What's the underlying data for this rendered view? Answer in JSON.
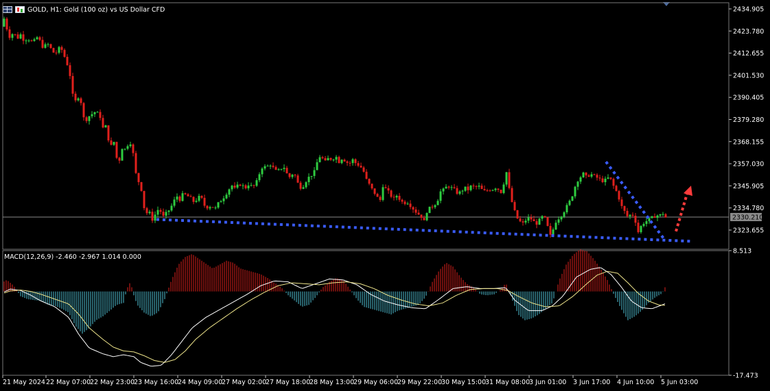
{
  "window": {
    "symbol": "GOLD",
    "timeframe": "H1",
    "description": "Gold (100 oz) vs US Dollar CFD",
    "title": "GOLD, H1:  Gold (100 oz) vs US Dollar CFD"
  },
  "price_axis": {
    "labels": [
      "2434.905",
      "2423.780",
      "2412.655",
      "2401.530",
      "2390.405",
      "2379.280",
      "2368.155",
      "2357.030",
      "2345.905",
      "2334.780",
      "2323.655"
    ],
    "values": [
      2434.905,
      2423.78,
      2412.655,
      2401.53,
      2390.405,
      2379.28,
      2368.155,
      2357.03,
      2345.905,
      2334.78,
      2323.655
    ],
    "current_price_label": "2330.210",
    "current_price": 2330.21,
    "range": [
      2314.0,
      2438.0
    ]
  },
  "macd": {
    "label": "MACD(12,26,9) -2.460 -2.967 1.014 0.000",
    "axis_labels": [
      "8.513",
      "-17.473"
    ],
    "axis_values": [
      8.513,
      -17.473
    ]
  },
  "time_axis": {
    "labels": [
      "21 May 2024",
      "22 May 07:00",
      "22 May 23:00",
      "23 May 16:00",
      "24 May 09:00",
      "27 May 02:00",
      "27 May 18:00",
      "28 May 13:00",
      "29 May 06:00",
      "29 May 22:00",
      "30 May 15:00",
      "31 May 08:00",
      "3 Jun 01:00",
      "3 Jun 17:00",
      "4 Jun 10:00",
      "5 Jun 03:00"
    ]
  },
  "colors": {
    "background": "#000000",
    "bull": "#2ecc40",
    "bear": "#e0201c",
    "grid": "#3a3a3a",
    "axis": "#c0c0c0",
    "macd_pos": "#e0201c",
    "macd_neg": "#4fc3d9",
    "macd_line": "#ffffff",
    "signal_line": "#f0e68c",
    "trendline": "#3a5cff",
    "forecast_arrow": "#ff3b3b"
  },
  "chart_data": {
    "type": "candlestick",
    "title": "GOLD, H1:  Gold (100 oz) vs US Dollar CFD",
    "close_path": [
      [
        0,
        2426
      ],
      [
        3,
        2433
      ],
      [
        6,
        2430
      ],
      [
        10,
        2425
      ],
      [
        14,
        2421
      ],
      [
        20,
        2423
      ],
      [
        25,
        2420
      ],
      [
        30,
        2422
      ],
      [
        35,
        2419
      ],
      [
        40,
        2420
      ],
      [
        48,
        2418
      ],
      [
        55,
        2421
      ],
      [
        62,
        2416
      ],
      [
        70,
        2417
      ],
      [
        80,
        2412
      ],
      [
        88,
        2416
      ],
      [
        95,
        2410
      ],
      [
        100,
        2405
      ],
      [
        104,
        2398
      ],
      [
        108,
        2385
      ],
      [
        112,
        2392
      ],
      [
        118,
        2388
      ],
      [
        123,
        2378
      ],
      [
        130,
        2381
      ],
      [
        138,
        2383
      ],
      [
        145,
        2382
      ],
      [
        150,
        2375
      ],
      [
        155,
        2376
      ],
      [
        160,
        2365
      ],
      [
        166,
        2368
      ],
      [
        172,
        2356
      ],
      [
        178,
        2365
      ],
      [
        184,
        2364
      ],
      [
        188,
        2369
      ],
      [
        192,
        2366
      ],
      [
        195,
        2360
      ],
      [
        198,
        2352
      ],
      [
        202,
        2348
      ],
      [
        206,
        2344
      ],
      [
        209,
        2336
      ],
      [
        213,
        2332
      ],
      [
        217,
        2333
      ],
      [
        222,
        2329
      ],
      [
        227,
        2332
      ],
      [
        232,
        2335
      ],
      [
        237,
        2330
      ],
      [
        242,
        2332
      ],
      [
        247,
        2334
      ],
      [
        252,
        2337
      ],
      [
        257,
        2341
      ],
      [
        262,
        2339
      ],
      [
        267,
        2342
      ],
      [
        272,
        2341
      ],
      [
        277,
        2340
      ],
      [
        282,
        2338
      ],
      [
        287,
        2339
      ],
      [
        292,
        2341
      ],
      [
        298,
        2336
      ],
      [
        303,
        2335
      ],
      [
        308,
        2336
      ],
      [
        313,
        2334
      ],
      [
        318,
        2337
      ],
      [
        323,
        2339
      ],
      [
        328,
        2341
      ],
      [
        333,
        2344
      ],
      [
        338,
        2346
      ],
      [
        343,
        2344
      ],
      [
        348,
        2347
      ],
      [
        353,
        2346
      ],
      [
        358,
        2345
      ],
      [
        363,
        2347
      ],
      [
        368,
        2345
      ],
      [
        373,
        2347
      ],
      [
        378,
        2352
      ],
      [
        383,
        2356
      ],
      [
        388,
        2355
      ],
      [
        393,
        2357
      ],
      [
        398,
        2355
      ],
      [
        403,
        2353
      ],
      [
        408,
        2354
      ],
      [
        413,
        2356
      ],
      [
        418,
        2352
      ],
      [
        423,
        2350
      ],
      [
        428,
        2353
      ],
      [
        433,
        2348
      ],
      [
        437,
        2345
      ],
      [
        442,
        2346
      ],
      [
        447,
        2349
      ],
      [
        452,
        2351
      ],
      [
        457,
        2352
      ],
      [
        461,
        2356
      ],
      [
        464,
        2361
      ],
      [
        469,
        2360
      ],
      [
        474,
        2358
      ],
      [
        479,
        2360
      ],
      [
        484,
        2359
      ],
      [
        489,
        2361
      ],
      [
        494,
        2358
      ],
      [
        499,
        2360
      ],
      [
        504,
        2358
      ],
      [
        509,
        2357
      ],
      [
        514,
        2359
      ],
      [
        519,
        2357
      ],
      [
        524,
        2356
      ],
      [
        529,
        2354
      ],
      [
        534,
        2349
      ],
      [
        539,
        2346
      ],
      [
        544,
        2343
      ],
      [
        549,
        2341
      ],
      [
        553,
        2337
      ],
      [
        558,
        2346
      ],
      [
        563,
        2344
      ],
      [
        568,
        2342
      ],
      [
        573,
        2339
      ],
      [
        578,
        2341
      ],
      [
        583,
        2339
      ],
      [
        588,
        2337
      ],
      [
        593,
        2338
      ],
      [
        598,
        2336
      ],
      [
        603,
        2334
      ],
      [
        608,
        2332
      ],
      [
        613,
        2331
      ],
      [
        618,
        2328
      ],
      [
        622,
        2333
      ],
      [
        627,
        2335
      ],
      [
        632,
        2336
      ],
      [
        637,
        2338
      ],
      [
        642,
        2343
      ],
      [
        647,
        2344
      ],
      [
        652,
        2346
      ],
      [
        657,
        2345
      ],
      [
        662,
        2344
      ],
      [
        667,
        2342
      ],
      [
        672,
        2343
      ],
      [
        677,
        2345
      ],
      [
        682,
        2344
      ],
      [
        687,
        2346
      ],
      [
        692,
        2345
      ],
      [
        697,
        2346
      ],
      [
        702,
        2344
      ],
      [
        707,
        2343
      ],
      [
        712,
        2344
      ],
      [
        717,
        2344
      ],
      [
        722,
        2345
      ],
      [
        727,
        2344
      ],
      [
        732,
        2342
      ],
      [
        737,
        2355
      ],
      [
        741,
        2346
      ],
      [
        745,
        2339
      ],
      [
        749,
        2334
      ],
      [
        753,
        2330
      ],
      [
        757,
        2328
      ],
      [
        762,
        2327
      ],
      [
        767,
        2329
      ],
      [
        772,
        2330
      ],
      [
        777,
        2328
      ],
      [
        782,
        2327
      ],
      [
        787,
        2329
      ],
      [
        792,
        2331
      ],
      [
        797,
        2327
      ],
      [
        801,
        2320
      ],
      [
        805,
        2323
      ],
      [
        810,
        2328
      ],
      [
        815,
        2330
      ],
      [
        820,
        2332
      ],
      [
        825,
        2335
      ],
      [
        830,
        2338
      ],
      [
        835,
        2342
      ],
      [
        840,
        2348
      ],
      [
        845,
        2350
      ],
      [
        850,
        2352
      ],
      [
        855,
        2350
      ],
      [
        860,
        2352
      ],
      [
        865,
        2351
      ],
      [
        870,
        2350
      ],
      [
        875,
        2349
      ],
      [
        880,
        2348
      ],
      [
        885,
        2350
      ],
      [
        890,
        2349
      ],
      [
        895,
        2345
      ],
      [
        900,
        2342
      ],
      [
        905,
        2336
      ],
      [
        910,
        2333
      ],
      [
        915,
        2330
      ],
      [
        920,
        2332
      ],
      [
        925,
        2330
      ],
      [
        929,
        2322
      ],
      [
        933,
        2325
      ],
      [
        937,
        2327
      ],
      [
        941,
        2328
      ],
      [
        946,
        2329
      ],
      [
        951,
        2330
      ],
      [
        956,
        2331
      ],
      [
        961,
        2331
      ],
      [
        966,
        2332
      ],
      [
        970,
        2330
      ]
    ],
    "macd_histogram_profile": [
      [
        0,
        0.8
      ],
      [
        10,
        1.2
      ],
      [
        20,
        0.6
      ],
      [
        30,
        -0.5
      ],
      [
        40,
        -0.8
      ],
      [
        50,
        -0.9
      ],
      [
        60,
        -1.0
      ],
      [
        70,
        -1.4
      ],
      [
        80,
        -1.5
      ],
      [
        90,
        -1.8
      ],
      [
        100,
        -2.2
      ],
      [
        110,
        -3.6
      ],
      [
        120,
        -4.4
      ],
      [
        130,
        -3.8
      ],
      [
        140,
        -3.0
      ],
      [
        150,
        -2.6
      ],
      [
        160,
        -2.0
      ],
      [
        170,
        -1.4
      ],
      [
        180,
        -1.2
      ],
      [
        185,
        0.3
      ],
      [
        190,
        1.0
      ],
      [
        195,
        -0.4
      ],
      [
        200,
        -1.4
      ],
      [
        210,
        -2.2
      ],
      [
        220,
        -2.6
      ],
      [
        230,
        -2.2
      ],
      [
        240,
        -0.8
      ],
      [
        250,
        1.2
      ],
      [
        260,
        2.8
      ],
      [
        270,
        3.6
      ],
      [
        280,
        3.9
      ],
      [
        290,
        3.4
      ],
      [
        300,
        2.9
      ],
      [
        310,
        2.4
      ],
      [
        320,
        2.8
      ],
      [
        330,
        3.2
      ],
      [
        340,
        3.0
      ],
      [
        350,
        2.4
      ],
      [
        360,
        2.2
      ],
      [
        370,
        2.0
      ],
      [
        380,
        1.8
      ],
      [
        390,
        1.4
      ],
      [
        400,
        0.9
      ],
      [
        410,
        0.4
      ],
      [
        420,
        -0.4
      ],
      [
        430,
        -1.0
      ],
      [
        440,
        -1.6
      ],
      [
        450,
        -1.4
      ],
      [
        460,
        -0.6
      ],
      [
        470,
        0.4
      ],
      [
        480,
        1.0
      ],
      [
        490,
        1.4
      ],
      [
        500,
        1.2
      ],
      [
        510,
        0.2
      ],
      [
        520,
        -0.8
      ],
      [
        530,
        -1.6
      ],
      [
        540,
        -1.8
      ],
      [
        550,
        -2.0
      ],
      [
        560,
        -2.2
      ],
      [
        570,
        -2.4
      ],
      [
        580,
        -2.0
      ],
      [
        590,
        -1.8
      ],
      [
        600,
        -1.6
      ],
      [
        610,
        -1.4
      ],
      [
        620,
        -0.6
      ],
      [
        630,
        1.0
      ],
      [
        640,
        2.2
      ],
      [
        650,
        3.0
      ],
      [
        660,
        2.6
      ],
      [
        670,
        1.6
      ],
      [
        680,
        0.8
      ],
      [
        690,
        0.4
      ],
      [
        700,
        -0.3
      ],
      [
        710,
        -0.4
      ],
      [
        720,
        -0.3
      ],
      [
        730,
        0.2
      ],
      [
        737,
        0.9
      ],
      [
        745,
        -0.6
      ],
      [
        755,
        -2.4
      ],
      [
        765,
        -3.0
      ],
      [
        775,
        -2.8
      ],
      [
        785,
        -2.4
      ],
      [
        795,
        -1.8
      ],
      [
        805,
        -1.2
      ],
      [
        815,
        1.2
      ],
      [
        825,
        2.8
      ],
      [
        835,
        3.8
      ],
      [
        845,
        4.4
      ],
      [
        855,
        4.2
      ],
      [
        865,
        3.4
      ],
      [
        875,
        2.4
      ],
      [
        885,
        1.2
      ],
      [
        895,
        -0.4
      ],
      [
        905,
        -1.8
      ],
      [
        915,
        -3.0
      ],
      [
        925,
        -2.6
      ],
      [
        935,
        -2.0
      ],
      [
        945,
        -1.2
      ],
      [
        955,
        -0.6
      ],
      [
        965,
        -0.2
      ],
      [
        970,
        0.6
      ]
    ],
    "macd_line_profile": [
      [
        0,
        -0.5
      ],
      [
        15,
        0.5
      ],
      [
        30,
        0.2
      ],
      [
        45,
        -0.8
      ],
      [
        60,
        -2.0
      ],
      [
        80,
        -3.2
      ],
      [
        100,
        -5.4
      ],
      [
        115,
        -9.0
      ],
      [
        130,
        -11.8
      ],
      [
        150,
        -13.0
      ],
      [
        165,
        -13.6
      ],
      [
        180,
        -13.2
      ],
      [
        195,
        -13.6
      ],
      [
        205,
        -14.8
      ],
      [
        220,
        -15.6
      ],
      [
        235,
        -15.4
      ],
      [
        250,
        -13.2
      ],
      [
        265,
        -10.4
      ],
      [
        280,
        -7.6
      ],
      [
        300,
        -5.4
      ],
      [
        320,
        -3.8
      ],
      [
        340,
        -2.2
      ],
      [
        360,
        -0.6
      ],
      [
        380,
        1.2
      ],
      [
        400,
        2.2
      ],
      [
        420,
        2.0
      ],
      [
        440,
        0.6
      ],
      [
        460,
        1.6
      ],
      [
        480,
        2.6
      ],
      [
        500,
        2.4
      ],
      [
        520,
        1.4
      ],
      [
        540,
        -0.6
      ],
      [
        560,
        -2.0
      ],
      [
        580,
        -2.8
      ],
      [
        600,
        -3.4
      ],
      [
        620,
        -3.6
      ],
      [
        640,
        -1.6
      ],
      [
        660,
        0.6
      ],
      [
        680,
        1.0
      ],
      [
        700,
        0.6
      ],
      [
        720,
        0.6
      ],
      [
        737,
        0.8
      ],
      [
        750,
        -1.8
      ],
      [
        770,
        -4.0
      ],
      [
        790,
        -4.0
      ],
      [
        805,
        -3.0
      ],
      [
        820,
        -1.0
      ],
      [
        840,
        3.0
      ],
      [
        860,
        4.6
      ],
      [
        875,
        5.0
      ],
      [
        890,
        3.6
      ],
      [
        905,
        1.0
      ],
      [
        920,
        -2.0
      ],
      [
        935,
        -3.4
      ],
      [
        950,
        -3.6
      ],
      [
        965,
        -2.8
      ],
      [
        970,
        -2.5
      ]
    ],
    "signal_line_profile": [
      [
        0,
        -0.6
      ],
      [
        15,
        0.1
      ],
      [
        30,
        0.3
      ],
      [
        45,
        0.0
      ],
      [
        60,
        -0.6
      ],
      [
        80,
        -1.6
      ],
      [
        100,
        -2.6
      ],
      [
        115,
        -4.8
      ],
      [
        130,
        -7.6
      ],
      [
        150,
        -10.0
      ],
      [
        165,
        -11.6
      ],
      [
        180,
        -12.4
      ],
      [
        195,
        -12.6
      ],
      [
        210,
        -13.4
      ],
      [
        225,
        -14.4
      ],
      [
        240,
        -14.8
      ],
      [
        255,
        -14.2
      ],
      [
        270,
        -12.4
      ],
      [
        285,
        -10.0
      ],
      [
        305,
        -7.6
      ],
      [
        325,
        -5.6
      ],
      [
        345,
        -3.6
      ],
      [
        365,
        -1.8
      ],
      [
        385,
        -0.2
      ],
      [
        405,
        1.2
      ],
      [
        425,
        1.8
      ],
      [
        445,
        1.6
      ],
      [
        465,
        1.4
      ],
      [
        485,
        1.8
      ],
      [
        505,
        2.0
      ],
      [
        525,
        1.6
      ],
      [
        545,
        0.6
      ],
      [
        565,
        -0.8
      ],
      [
        585,
        -1.8
      ],
      [
        605,
        -2.6
      ],
      [
        625,
        -3.0
      ],
      [
        645,
        -2.4
      ],
      [
        665,
        -0.8
      ],
      [
        685,
        0.4
      ],
      [
        705,
        0.6
      ],
      [
        725,
        0.6
      ],
      [
        740,
        0.2
      ],
      [
        755,
        -1.0
      ],
      [
        775,
        -2.4
      ],
      [
        795,
        -3.2
      ],
      [
        815,
        -3.0
      ],
      [
        835,
        -1.0
      ],
      [
        855,
        1.6
      ],
      [
        870,
        3.4
      ],
      [
        885,
        4.2
      ],
      [
        900,
        3.8
      ],
      [
        915,
        1.8
      ],
      [
        930,
        -0.4
      ],
      [
        945,
        -2.0
      ],
      [
        960,
        -2.8
      ],
      [
        970,
        -2.9
      ]
    ],
    "annotations": [
      {
        "type": "support-trendline",
        "from": [
          228,
          2329
        ],
        "to": [
          1008,
          2318
        ]
      },
      {
        "type": "resistance-trendline",
        "from": [
          883,
          2358
        ],
        "to": [
          968,
          2319
        ]
      },
      {
        "type": "forecast-arrow",
        "direction": "up",
        "from": [
          985,
          2323
        ],
        "to": [
          1005,
          2346
        ]
      }
    ]
  }
}
